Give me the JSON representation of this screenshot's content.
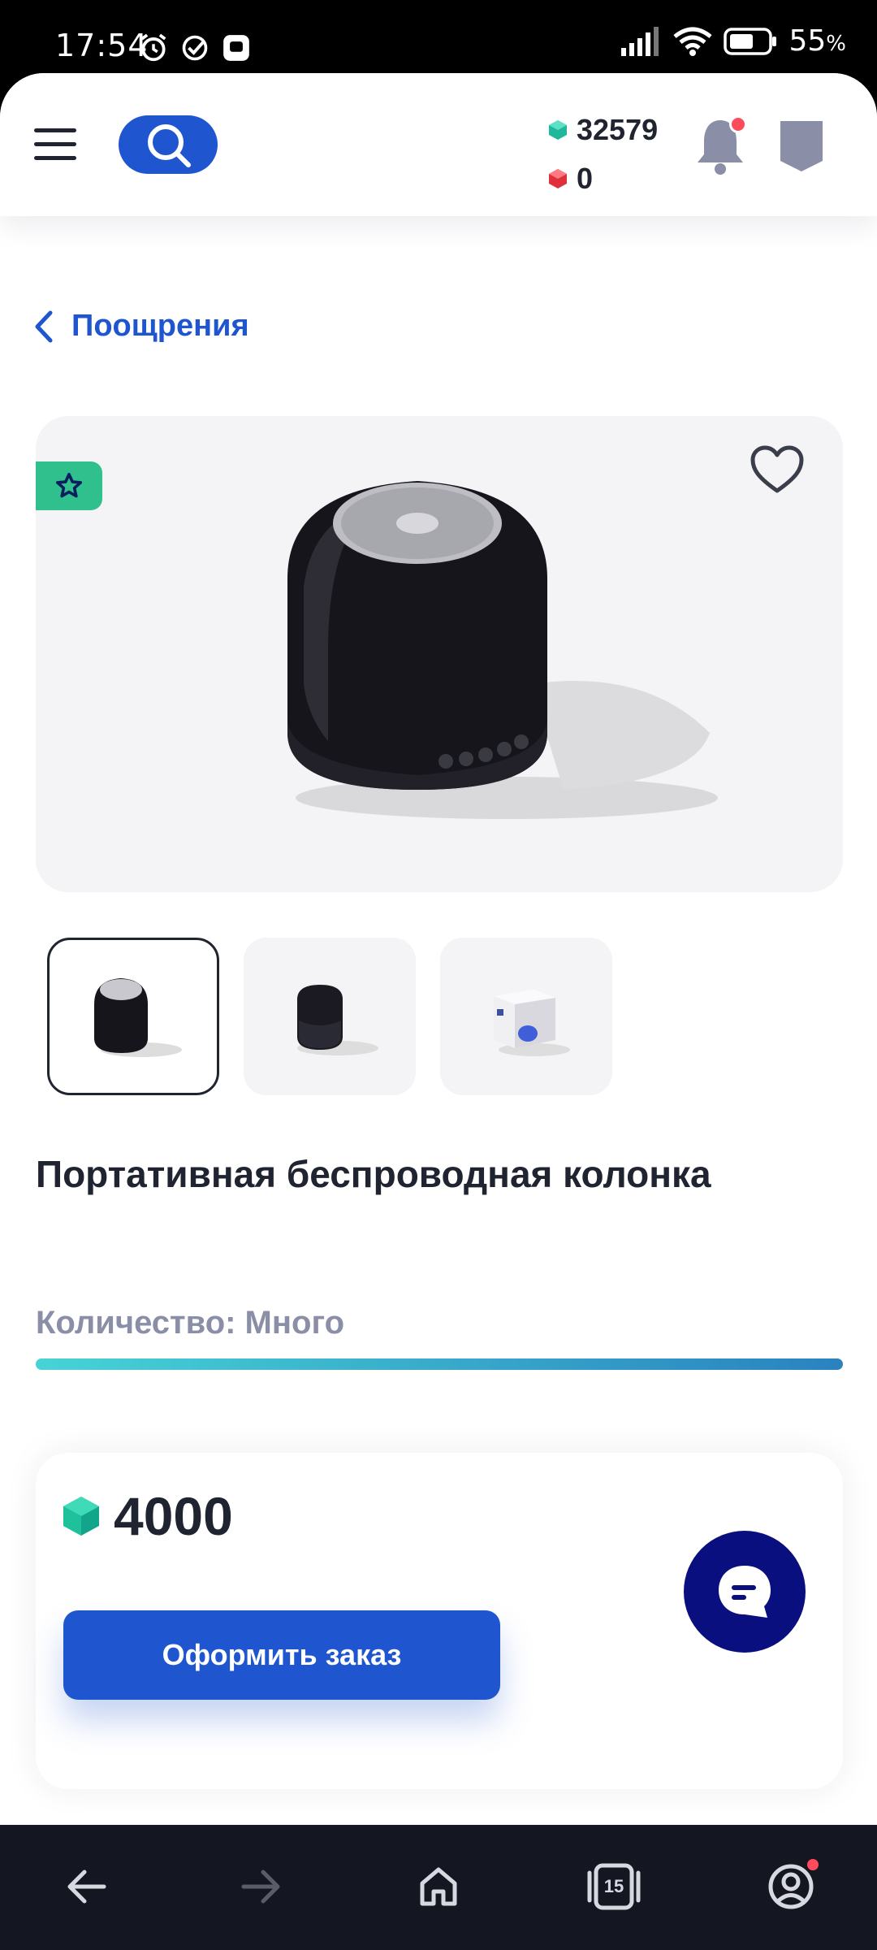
{
  "status_bar": {
    "time": "17:54",
    "battery_percent": "55",
    "battery_unit": "%",
    "icons": [
      "alarm-icon",
      "check-circle-icon",
      "notification-app-icon",
      "signal-icon",
      "wifi-icon",
      "battery-icon"
    ]
  },
  "header": {
    "menu_icon": "hamburger-icon",
    "search_icon": "search-icon",
    "balances": {
      "green_points": "32579",
      "red_points": "0"
    },
    "bell_icon": "bell-icon",
    "profile_icon": "shield-icon",
    "colors": {
      "accent": "#1f56d0",
      "green_gem": "#1fb89a",
      "red_gem": "#e0303c",
      "alert_dot": "#ff4b5c"
    }
  },
  "breadcrumb": {
    "back_label": "Поощрения"
  },
  "product": {
    "title": "Портативная беспроводная колонка",
    "quantity_label": "Количество: Много",
    "thumbnails": [
      "speaker-front",
      "speaker-dark",
      "speaker-box"
    ],
    "active_thumbnail": 0
  },
  "order": {
    "price": "4000",
    "button_label": "Оформить заказ"
  },
  "nav": {
    "tabs_count": "15",
    "items": [
      "back-icon",
      "forward-icon",
      "home-icon",
      "tabs-icon",
      "account-icon"
    ]
  }
}
